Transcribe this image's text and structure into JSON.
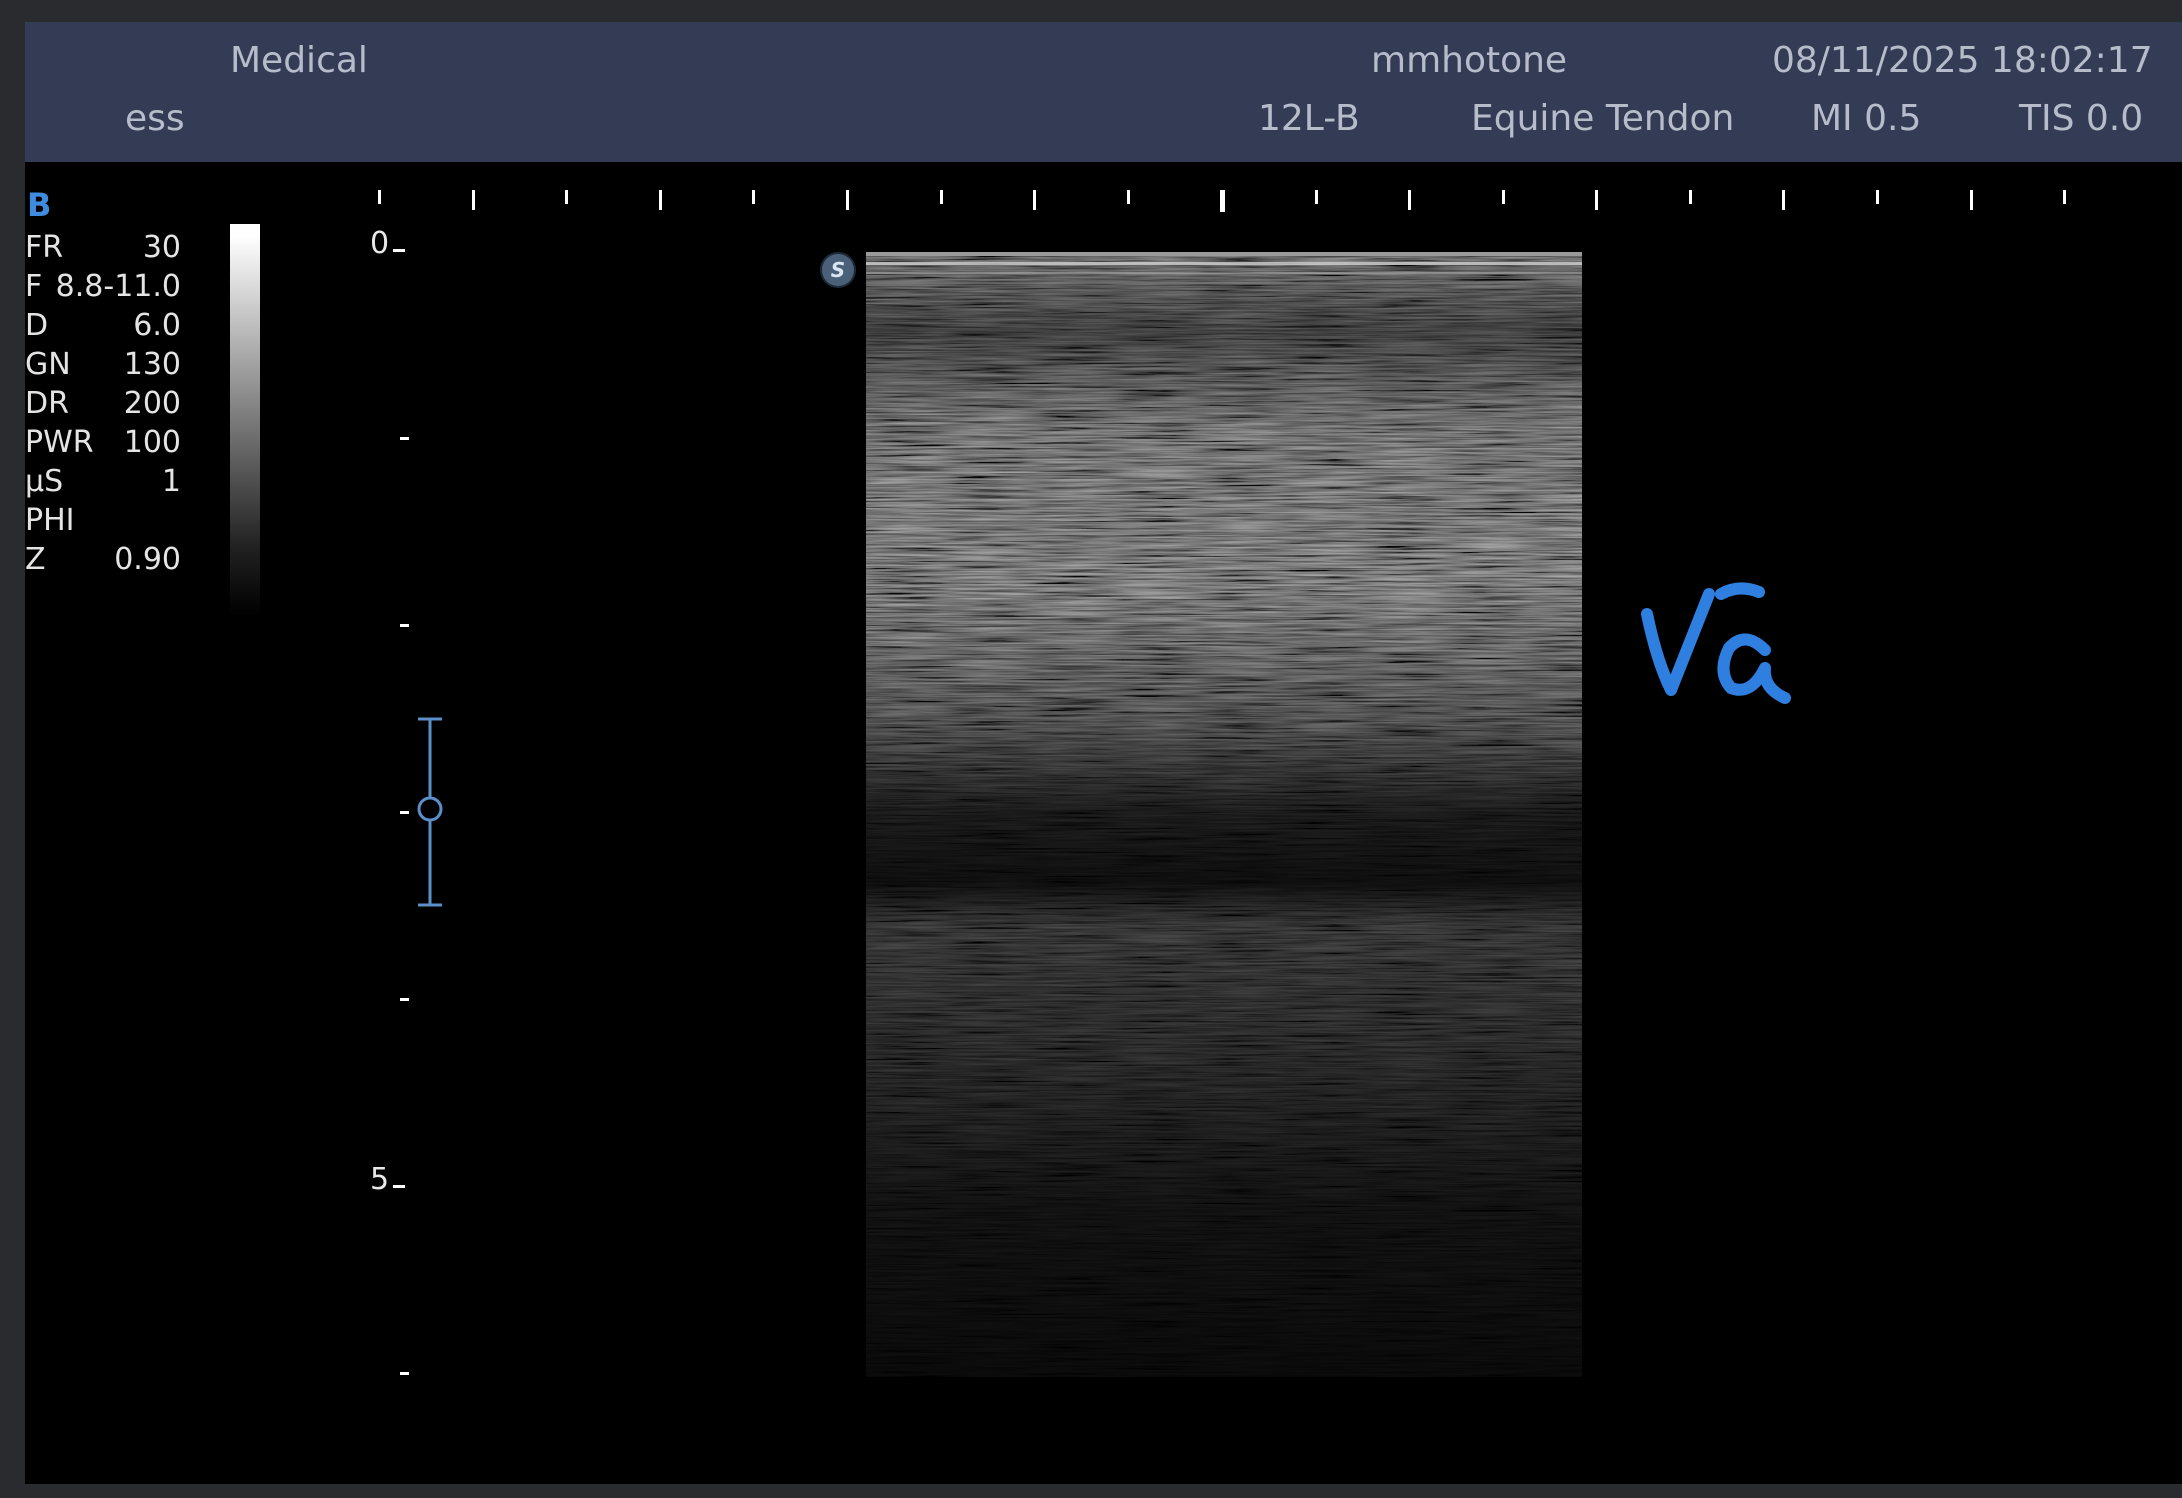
{
  "header": {
    "site": "Medical",
    "preset_short": "ess",
    "operator": "mmhotone",
    "datetime": "08/11/2025 18:02:17",
    "probe": "12L-B",
    "exam": "Equine Tendon",
    "mi": "MI 0.5",
    "tis": "TIS 0.0"
  },
  "mode": "B",
  "params": [
    {
      "key": "FR",
      "value": "30"
    },
    {
      "key": "F",
      "value": "8.8-11.0"
    },
    {
      "key": "D",
      "value": "6.0"
    },
    {
      "key": "GN",
      "value": "130"
    },
    {
      "key": "DR",
      "value": "200"
    },
    {
      "key": "PWR",
      "value": "100"
    },
    {
      "key": "µS",
      "value": "1"
    },
    {
      "key": "PHI",
      "value": ""
    },
    {
      "key": "Z",
      "value": "0.90"
    }
  ],
  "depth_scale": {
    "top_label": "0",
    "mid_label": "5"
  },
  "image": {
    "marker": "S"
  },
  "annotation": {
    "text": "Vã",
    "color": "#2f7fe0"
  },
  "colors": {
    "header_bg": "#343b55",
    "header_text": "#b7bccb",
    "accent": "#3f8be0",
    "background": "#000000"
  }
}
